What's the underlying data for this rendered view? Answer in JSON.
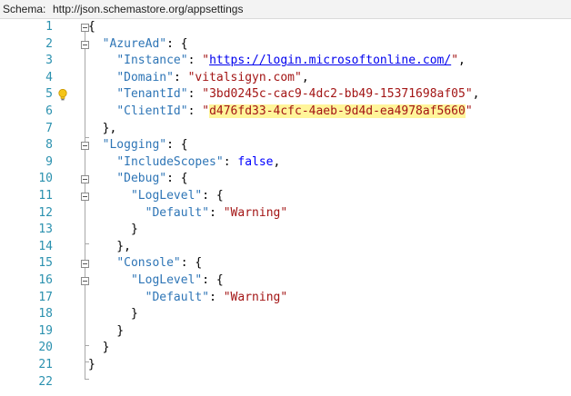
{
  "schema": {
    "label": "Schema:",
    "url": "http://json.schemastore.org/appsettings"
  },
  "lines": [
    {
      "n": "1"
    },
    {
      "n": "2"
    },
    {
      "n": "3"
    },
    {
      "n": "4"
    },
    {
      "n": "5"
    },
    {
      "n": "6"
    },
    {
      "n": "7"
    },
    {
      "n": "8"
    },
    {
      "n": "9"
    },
    {
      "n": "10"
    },
    {
      "n": "11"
    },
    {
      "n": "12"
    },
    {
      "n": "13"
    },
    {
      "n": "14"
    },
    {
      "n": "15"
    },
    {
      "n": "16"
    },
    {
      "n": "17"
    },
    {
      "n": "18"
    },
    {
      "n": "19"
    },
    {
      "n": "20"
    },
    {
      "n": "21"
    },
    {
      "n": "22"
    }
  ],
  "code": {
    "l1": "{",
    "azuread_key": "\"AzureAd\"",
    "instance_key": "\"Instance\"",
    "instance_val": "https://login.microsoftonline.com/",
    "domain_key": "\"Domain\"",
    "domain_val": "\"vitalsigyn.com\"",
    "tenant_key": "\"TenantId\"",
    "tenant_val": "\"3bd0245c-cac9-4dc2-bb49-15371698af05\"",
    "client_key": "\"ClientId\"",
    "client_val": "d476fd33-4cfc-4aeb-9d4d-ea4978af5660",
    "logging_key": "\"Logging\"",
    "includescopes_key": "\"IncludeScopes\"",
    "includescopes_val": "false",
    "debug_key": "\"Debug\"",
    "loglevel_key": "\"LogLevel\"",
    "default_key": "\"Default\"",
    "default_val": "\"Warning\"",
    "console_key": "\"Console\""
  },
  "colors": {
    "highlight": "#fff59a",
    "key": "#2e75b6",
    "string": "#a31515",
    "keyword": "#0000ff",
    "line_number": "#2b91af"
  }
}
